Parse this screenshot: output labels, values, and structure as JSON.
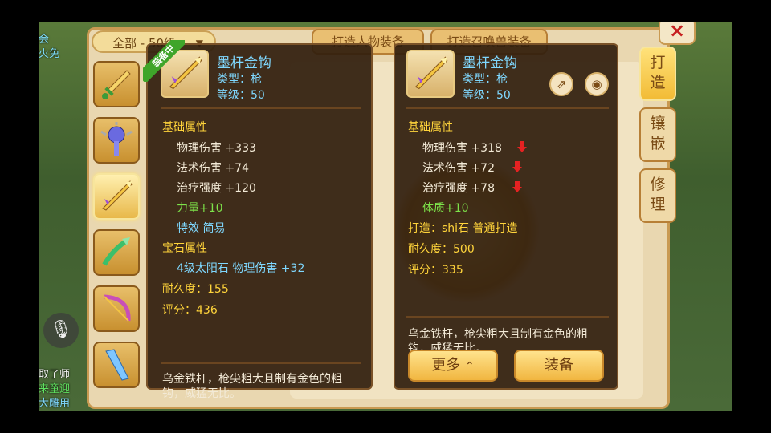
{
  "chat": {
    "lines": [
      "会",
      "火免",
      "取了师",
      "来童迎",
      "大雕用"
    ]
  },
  "filter": {
    "label": "全部 - 50级"
  },
  "top_tabs": {
    "forge_character": "打造人物装备",
    "forge_summon": "打造召唤兽装备"
  },
  "close": {
    "label": "×"
  },
  "side_tabs": [
    {
      "line1": "打",
      "line2": "造"
    },
    {
      "line1": "镶",
      "line2": "嵌"
    },
    {
      "line1": "修",
      "line2": "理"
    }
  ],
  "left_panel": {
    "badge": "装备中",
    "name": "墨杆金钩",
    "type_line": "类型：枪",
    "level_line": "等级：50",
    "base_attr_title": "基础属性",
    "attrs": [
      {
        "text": "物理伤害 +333"
      },
      {
        "text": "法术伤害 +74"
      },
      {
        "text": "治疗强度 +120"
      }
    ],
    "bonus": "力量+10",
    "special": "特效 简易",
    "gem_title": "宝石属性",
    "gem_line": "4级太阳石 物理伤害 +32",
    "durability": "耐久度：155",
    "score": "评分：436",
    "description": "乌金铁杆，枪尖粗大且制有金色的粗钩，威猛无比。"
  },
  "right_panel": {
    "name": "墨杆金钩",
    "type_line": "类型：枪",
    "level_line": "等级：50",
    "base_attr_title": "基础属性",
    "attrs": [
      {
        "text": "物理伤害 +318",
        "down": true
      },
      {
        "text": "法术伤害 +72",
        "down": true
      },
      {
        "text": "治疗强度 +78",
        "down": true
      }
    ],
    "bonus": "体质+10",
    "forge_line": "打造：shi石  普通打造",
    "durability": "耐久度：500",
    "score": "评分：335",
    "description": "乌金铁杆，枪尖粗大且制有金色的粗钩，威猛无比。",
    "more_button": "更多",
    "equip_button": "装备"
  },
  "icons": {
    "share": "share-icon",
    "view": "eye-icon",
    "chevron": "chevron-up-icon"
  },
  "colors": {
    "name": "#7fd8ff",
    "gold_title": "#ffd43b",
    "bonus_green": "#7de34a",
    "decrease_red": "#e52222",
    "panel_bg": "#301d0d"
  }
}
